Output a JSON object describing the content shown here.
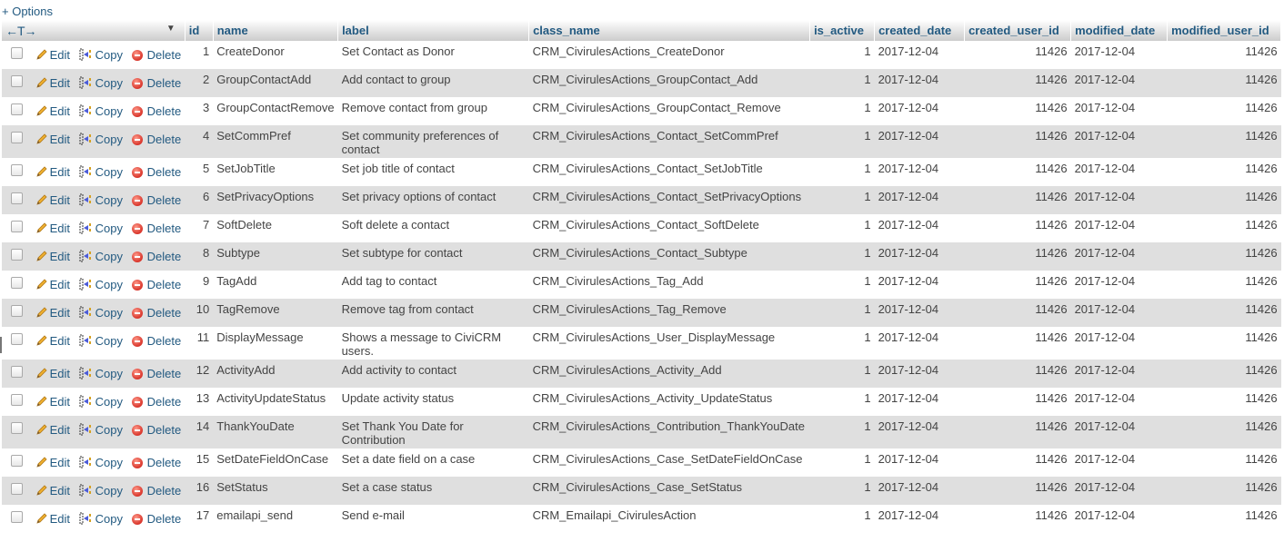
{
  "options_link": "+ Options",
  "header": {
    "nav_arrows": "←T→",
    "sort_indicator": "▼",
    "columns": [
      "id",
      "name",
      "label",
      "class_name",
      "is_active",
      "created_date",
      "created_user_id",
      "modified_date",
      "modified_user_id"
    ]
  },
  "actions": {
    "edit": "Edit",
    "copy": "Copy",
    "delete": "Delete",
    "icons": {
      "edit": "pencil-icon",
      "copy": "copy-icon",
      "delete": "delete-icon"
    }
  },
  "colors": {
    "link": "#235a81",
    "even_row": "#dfdfdf",
    "text": "#444444"
  },
  "rows": [
    {
      "id": "1",
      "name": "CreateDonor",
      "label": "Set Contact as Donor",
      "class_name": "CRM_CivirulesActions_CreateDonor",
      "is_active": "1",
      "created_date": "2017-12-04",
      "created_user_id": "11426",
      "modified_date": "2017-12-04",
      "modified_user_id": "11426"
    },
    {
      "id": "2",
      "name": "GroupContactAdd",
      "label": "Add contact to group",
      "class_name": "CRM_CivirulesActions_GroupContact_Add",
      "is_active": "1",
      "created_date": "2017-12-04",
      "created_user_id": "11426",
      "modified_date": "2017-12-04",
      "modified_user_id": "11426"
    },
    {
      "id": "3",
      "name": "GroupContactRemove",
      "label": "Remove contact from group",
      "class_name": "CRM_CivirulesActions_GroupContact_Remove",
      "is_active": "1",
      "created_date": "2017-12-04",
      "created_user_id": "11426",
      "modified_date": "2017-12-04",
      "modified_user_id": "11426"
    },
    {
      "id": "4",
      "name": "SetCommPref",
      "label": "Set community preferences of contact",
      "class_name": "CRM_CivirulesActions_Contact_SetCommPref",
      "is_active": "1",
      "created_date": "2017-12-04",
      "created_user_id": "11426",
      "modified_date": "2017-12-04",
      "modified_user_id": "11426"
    },
    {
      "id": "5",
      "name": "SetJobTitle",
      "label": "Set job title of contact",
      "class_name": "CRM_CivirulesActions_Contact_SetJobTitle",
      "is_active": "1",
      "created_date": "2017-12-04",
      "created_user_id": "11426",
      "modified_date": "2017-12-04",
      "modified_user_id": "11426"
    },
    {
      "id": "6",
      "name": "SetPrivacyOptions",
      "label": "Set privacy options of contact",
      "class_name": "CRM_CivirulesActions_Contact_SetPrivacyOptions",
      "is_active": "1",
      "created_date": "2017-12-04",
      "created_user_id": "11426",
      "modified_date": "2017-12-04",
      "modified_user_id": "11426"
    },
    {
      "id": "7",
      "name": "SoftDelete",
      "label": "Soft delete a contact",
      "class_name": "CRM_CivirulesActions_Contact_SoftDelete",
      "is_active": "1",
      "created_date": "2017-12-04",
      "created_user_id": "11426",
      "modified_date": "2017-12-04",
      "modified_user_id": "11426"
    },
    {
      "id": "8",
      "name": "Subtype",
      "label": "Set subtype for contact",
      "class_name": "CRM_CivirulesActions_Contact_Subtype",
      "is_active": "1",
      "created_date": "2017-12-04",
      "created_user_id": "11426",
      "modified_date": "2017-12-04",
      "modified_user_id": "11426"
    },
    {
      "id": "9",
      "name": "TagAdd",
      "label": "Add tag to contact",
      "class_name": "CRM_CivirulesActions_Tag_Add",
      "is_active": "1",
      "created_date": "2017-12-04",
      "created_user_id": "11426",
      "modified_date": "2017-12-04",
      "modified_user_id": "11426"
    },
    {
      "id": "10",
      "name": "TagRemove",
      "label": "Remove tag from contact",
      "class_name": "CRM_CivirulesActions_Tag_Remove",
      "is_active": "1",
      "created_date": "2017-12-04",
      "created_user_id": "11426",
      "modified_date": "2017-12-04",
      "modified_user_id": "11426"
    },
    {
      "id": "11",
      "name": "DisplayMessage",
      "label": "Shows a message to CiviCRM users.",
      "class_name": "CRM_CivirulesActions_User_DisplayMessage",
      "is_active": "1",
      "created_date": "2017-12-04",
      "created_user_id": "11426",
      "modified_date": "2017-12-04",
      "modified_user_id": "11426"
    },
    {
      "id": "12",
      "name": "ActivityAdd",
      "label": "Add activity to contact",
      "class_name": "CRM_CivirulesActions_Activity_Add",
      "is_active": "1",
      "created_date": "2017-12-04",
      "created_user_id": "11426",
      "modified_date": "2017-12-04",
      "modified_user_id": "11426"
    },
    {
      "id": "13",
      "name": "ActivityUpdateStatus",
      "label": "Update activity status",
      "class_name": "CRM_CivirulesActions_Activity_UpdateStatus",
      "is_active": "1",
      "created_date": "2017-12-04",
      "created_user_id": "11426",
      "modified_date": "2017-12-04",
      "modified_user_id": "11426"
    },
    {
      "id": "14",
      "name": "ThankYouDate",
      "label": "Set Thank You Date for Contribution",
      "class_name": "CRM_CivirulesActions_Contribution_ThankYouDate",
      "is_active": "1",
      "created_date": "2017-12-04",
      "created_user_id": "11426",
      "modified_date": "2017-12-04",
      "modified_user_id": "11426"
    },
    {
      "id": "15",
      "name": "SetDateFieldOnCase",
      "label": "Set a date field on a case",
      "class_name": "CRM_CivirulesActions_Case_SetDateFieldOnCase",
      "is_active": "1",
      "created_date": "2017-12-04",
      "created_user_id": "11426",
      "modified_date": "2017-12-04",
      "modified_user_id": "11426"
    },
    {
      "id": "16",
      "name": "SetStatus",
      "label": "Set a case status",
      "class_name": "CRM_CivirulesActions_Case_SetStatus",
      "is_active": "1",
      "created_date": "2017-12-04",
      "created_user_id": "11426",
      "modified_date": "2017-12-04",
      "modified_user_id": "11426"
    },
    {
      "id": "17",
      "name": "emailapi_send",
      "label": "Send e-mail",
      "class_name": "CRM_Emailapi_CivirulesAction",
      "is_active": "1",
      "created_date": "2017-12-04",
      "created_user_id": "11426",
      "modified_date": "2017-12-04",
      "modified_user_id": "11426"
    }
  ]
}
